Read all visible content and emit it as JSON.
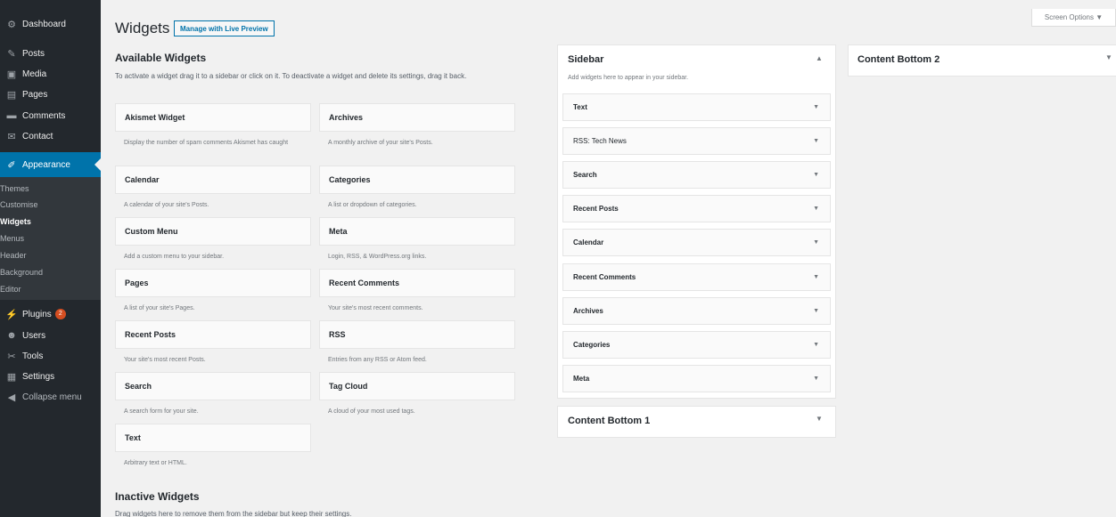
{
  "menu": {
    "items": [
      {
        "label": "Dashboard",
        "icon": "dashboard-icon",
        "glyph": "⚙"
      },
      {
        "label": "Posts",
        "icon": "pin-icon",
        "glyph": "✎"
      },
      {
        "label": "Media",
        "icon": "media-icon",
        "glyph": "▣"
      },
      {
        "label": "Pages",
        "icon": "page-icon",
        "glyph": "▤"
      },
      {
        "label": "Comments",
        "icon": "comment-icon",
        "glyph": "▬"
      },
      {
        "label": "Contact",
        "icon": "mail-icon",
        "glyph": "✉"
      },
      {
        "label": "Appearance",
        "icon": "brush-icon",
        "glyph": "✐"
      },
      {
        "label": "Plugins",
        "icon": "plug-icon",
        "glyph": "⚡",
        "badge": "2"
      },
      {
        "label": "Users",
        "icon": "users-icon",
        "glyph": "☻"
      },
      {
        "label": "Tools",
        "icon": "wrench-icon",
        "glyph": "✂"
      },
      {
        "label": "Settings",
        "icon": "settings-icon",
        "glyph": "▦"
      },
      {
        "label": "Collapse menu",
        "icon": "collapse-icon",
        "glyph": "◀"
      }
    ],
    "submenu": [
      "Themes",
      "Customise",
      "Widgets",
      "Menus",
      "Header",
      "Background",
      "Editor"
    ]
  },
  "header": {
    "title": "Widgets",
    "action": "Manage with Live Preview",
    "screen_options": "Screen Options ▼"
  },
  "available": {
    "title": "Available Widgets",
    "desc": "To activate a widget drag it to a sidebar or click on it. To deactivate a widget and delete its settings, drag it back.",
    "widgets": [
      {
        "name": "Akismet Widget",
        "desc": "Display the number of spam comments Akismet has caught"
      },
      {
        "name": "Archives",
        "desc": "A monthly archive of your site's Posts."
      },
      {
        "name": "Calendar",
        "desc": "A calendar of your site's Posts."
      },
      {
        "name": "Categories",
        "desc": "A list or dropdown of categories."
      },
      {
        "name": "Custom Menu",
        "desc": "Add a custom menu to your sidebar."
      },
      {
        "name": "Meta",
        "desc": "Login, RSS, & WordPress.org links."
      },
      {
        "name": "Pages",
        "desc": "A list of your site's Pages."
      },
      {
        "name": "Recent Comments",
        "desc": "Your site's most recent comments."
      },
      {
        "name": "Recent Posts",
        "desc": "Your site's most recent Posts."
      },
      {
        "name": "RSS",
        "desc": "Entries from any RSS or Atom feed."
      },
      {
        "name": "Search",
        "desc": "A search form for your site."
      },
      {
        "name": "Tag Cloud",
        "desc": "A cloud of your most used tags."
      },
      {
        "name": "Text",
        "desc": "Arbitrary text or HTML."
      }
    ]
  },
  "inactive": {
    "title": "Inactive Widgets",
    "desc": "Drag widgets here to remove them from the sidebar but keep their settings."
  },
  "sidebar": {
    "title": "Sidebar",
    "desc": "Add widgets here to appear in your sidebar.",
    "widgets": [
      "Text",
      "RSS: Tech News",
      "Search",
      "Recent Posts",
      "Calendar",
      "Recent Comments",
      "Archives",
      "Categories",
      "Meta"
    ]
  },
  "content_bottom_1": {
    "title": "Content Bottom 1"
  },
  "content_bottom_2": {
    "title": "Content Bottom 2"
  },
  "arrows": {
    "up": "▲",
    "down": "▼"
  }
}
